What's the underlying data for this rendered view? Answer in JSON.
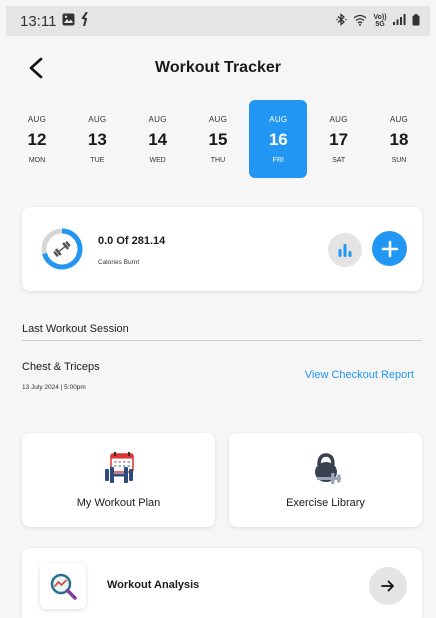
{
  "status_bar": {
    "time": "13:11",
    "left_icons": [
      "gallery-icon",
      "activity-icon"
    ],
    "right_icons": [
      "bluetooth-icon",
      "wifi-icon",
      "volte-icon",
      "signal-icon",
      "battery-icon"
    ],
    "volte_text": "Vo)) 5G"
  },
  "header": {
    "title": "Workout Tracker",
    "back_icon": "chevron-left-icon"
  },
  "week": [
    {
      "month": "AUG",
      "date": "12",
      "weekday": "MON",
      "selected": false
    },
    {
      "month": "AUG",
      "date": "13",
      "weekday": "TUE",
      "selected": false
    },
    {
      "month": "AUG",
      "date": "14",
      "weekday": "WED",
      "selected": false
    },
    {
      "month": "AUG",
      "date": "15",
      "weekday": "THU",
      "selected": false
    },
    {
      "month": "AUG",
      "date": "16",
      "weekday": "FRI",
      "selected": true
    },
    {
      "month": "AUG",
      "date": "17",
      "weekday": "SAT",
      "selected": false
    },
    {
      "month": "AUG",
      "date": "18",
      "weekday": "SUN",
      "selected": false
    }
  ],
  "calories": {
    "value_text": "0.0 Of 281.14",
    "label": "Calories Burnt",
    "progress": 0.0,
    "ring_icon": "dumbbell-icon"
  },
  "last_session": {
    "section_title": "Last Workout Session",
    "name": "Chest & Triceps",
    "date": "13 July 2024 | 5:00pm",
    "report_link": "View Checkout Report"
  },
  "tiles": {
    "plan_label": "My Workout Plan",
    "library_label": "Exercise Library"
  },
  "analysis": {
    "label": "Workout Analysis"
  },
  "colors": {
    "accent": "#2196f3",
    "background": "#f6f6f6",
    "card": "#ffffff",
    "muted_button": "#e4e4e4"
  }
}
